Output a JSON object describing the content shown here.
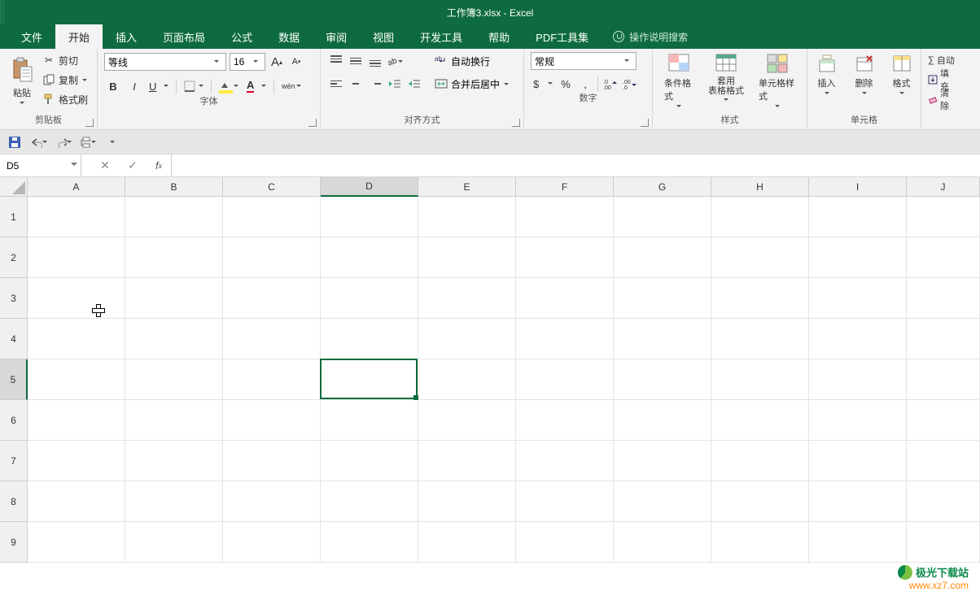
{
  "title": "工作簿3.xlsx  -  Excel",
  "tabs": [
    "文件",
    "开始",
    "插入",
    "页面布局",
    "公式",
    "数据",
    "审阅",
    "视图",
    "开发工具",
    "帮助",
    "PDF工具集"
  ],
  "active_tab_index": 1,
  "tell_me": "操作说明搜索",
  "clipboard": {
    "paste": "粘贴",
    "cut": "剪切",
    "copy": "复制",
    "format_painter": "格式刷",
    "group": "剪贴板"
  },
  "font": {
    "name": "等线",
    "size": "16",
    "grow": "A",
    "shrink": "A",
    "bold": "B",
    "italic": "I",
    "underline": "U",
    "group": "字体",
    "phonetic": "wén"
  },
  "alignment": {
    "wrap": "自动换行",
    "merge": "合并后居中",
    "group": "对齐方式"
  },
  "number": {
    "format": "常规",
    "group": "数字"
  },
  "styles": {
    "cond": "条件格式",
    "table": "套用\n表格格式",
    "cell": "单元格样式",
    "group": "样式"
  },
  "cells_grp": {
    "insert": "插入",
    "delete": "删除",
    "format": "格式",
    "group": "单元格"
  },
  "editing": {
    "autosum": "自动",
    "fill": "填充",
    "clear": "清除"
  },
  "namebox": "D5",
  "columns": [
    "A",
    "B",
    "C",
    "D",
    "E",
    "F",
    "G",
    "H",
    "I",
    "J"
  ],
  "rows": [
    "1",
    "2",
    "3",
    "4",
    "5",
    "6",
    "7",
    "8",
    "9"
  ],
  "selected": {
    "col_index": 3,
    "row_index": 4
  },
  "watermark": {
    "line1": "极光下载站",
    "line2": "www.xz7.com"
  }
}
